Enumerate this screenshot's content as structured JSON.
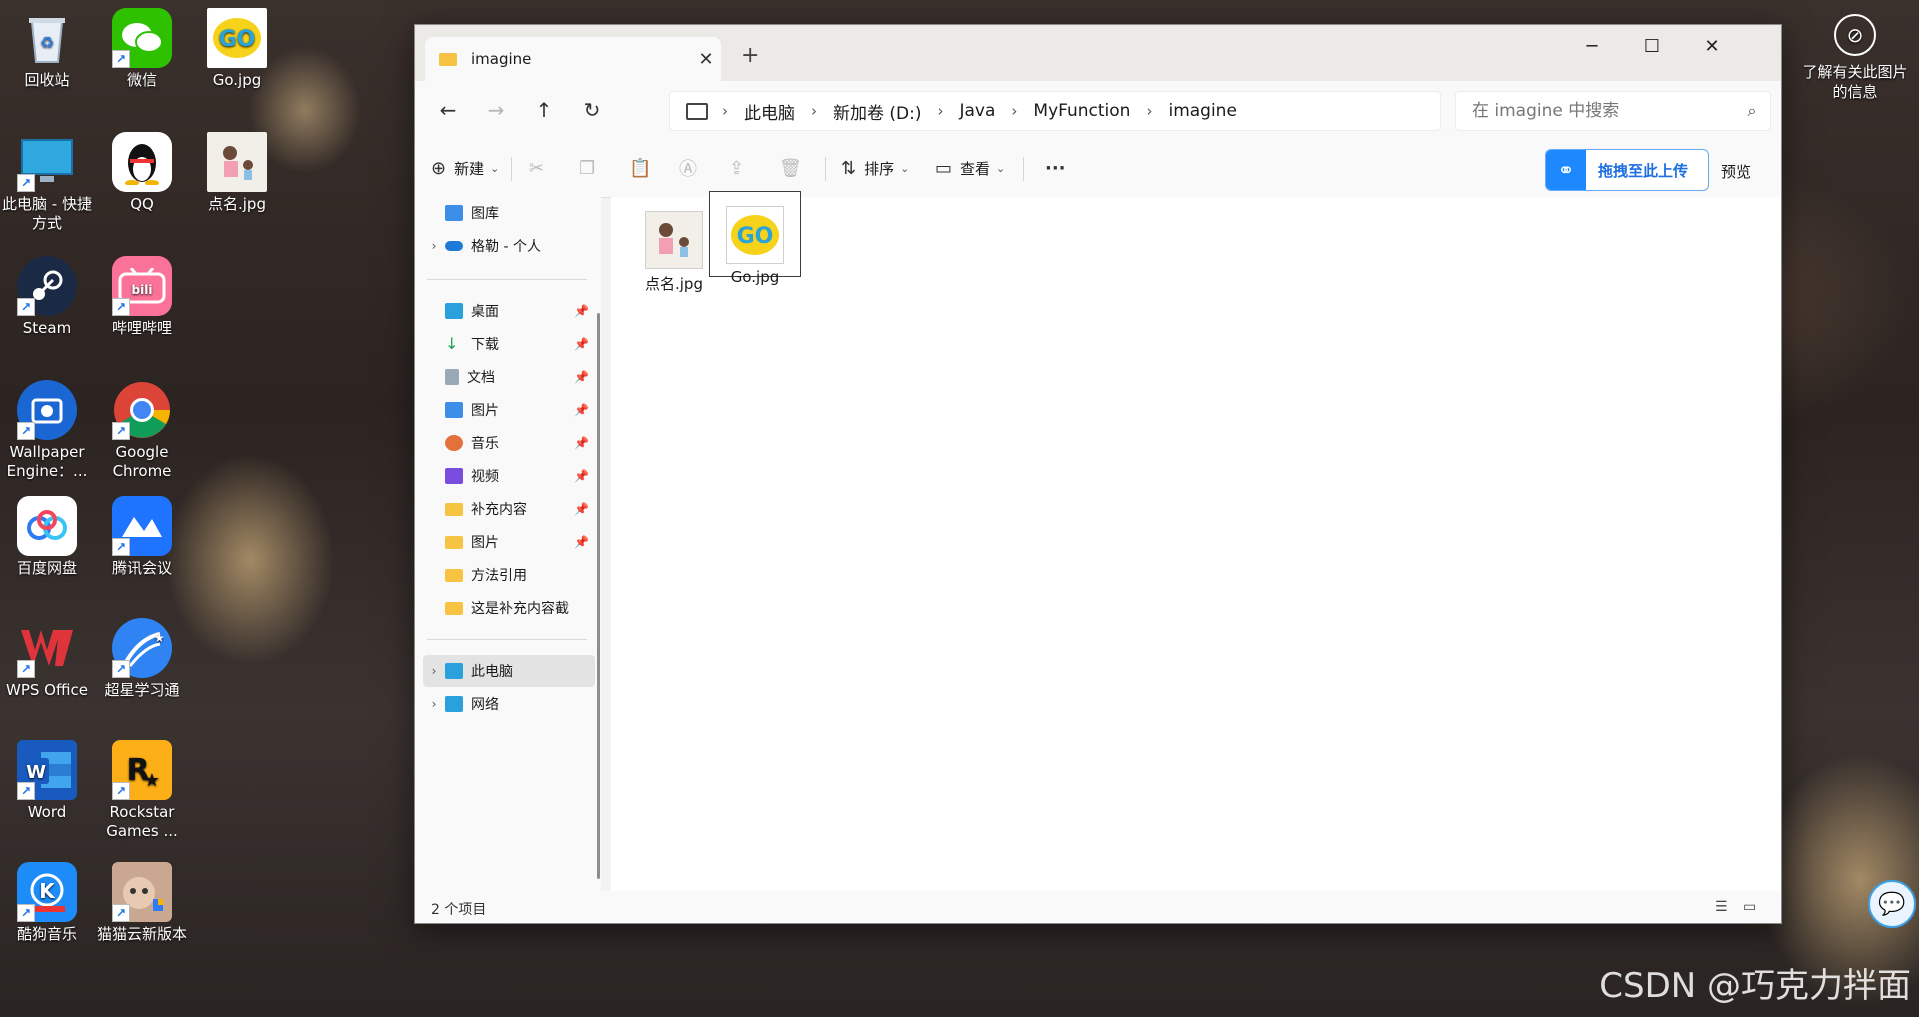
{
  "desktop": {
    "icons": [
      {
        "label": "回收站"
      },
      {
        "label": "微信"
      },
      {
        "label": "Go.jpg"
      },
      {
        "label": "此电脑 - 快捷方式"
      },
      {
        "label": "QQ"
      },
      {
        "label": "点名.jpg"
      },
      {
        "label": "Steam"
      },
      {
        "label": "哔哩哔哩"
      },
      {
        "label": "Wallpaper Engine：..."
      },
      {
        "label": "Google Chrome"
      },
      {
        "label": "百度网盘"
      },
      {
        "label": "腾讯会议"
      },
      {
        "label": "WPS Office"
      },
      {
        "label": "超星学习通"
      },
      {
        "label": "Word"
      },
      {
        "label": "Rockstar Games ..."
      },
      {
        "label": "酷狗音乐"
      },
      {
        "label": "猫猫云新版本"
      }
    ],
    "info_link": "了解有关此图片的信息",
    "watermark": "CSDN @巧克力拌面"
  },
  "window": {
    "tab_title": "imagine",
    "breadcrumb": [
      "此电脑",
      "新加卷 (D:)",
      "Java",
      "MyFunction",
      "imagine"
    ],
    "search_placeholder": "在 imagine 中搜索",
    "toolbar": {
      "new_label": "新建",
      "sort_label": "排序",
      "view_label": "查看",
      "upload_label": "拖拽至此上传",
      "preview_label": "预览"
    },
    "sidebar": {
      "top": [
        {
          "label": "图库"
        },
        {
          "label": "格勒 - 个人"
        }
      ],
      "quick": [
        {
          "label": "桌面"
        },
        {
          "label": "下载"
        },
        {
          "label": "文档"
        },
        {
          "label": "图片"
        },
        {
          "label": "音乐"
        },
        {
          "label": "视频"
        },
        {
          "label": "补充内容"
        },
        {
          "label": "图片"
        },
        {
          "label": "方法引用"
        },
        {
          "label": "这是补充内容截"
        }
      ],
      "bottom": [
        {
          "label": "此电脑"
        },
        {
          "label": "网络"
        }
      ]
    },
    "files": [
      {
        "name": "点名.jpg"
      },
      {
        "name": "Go.jpg"
      }
    ],
    "status": "2 个项目"
  },
  "colors": {
    "accent": "#1e88ff",
    "folder": "#f6c342",
    "selection": "#e3e3e3"
  }
}
